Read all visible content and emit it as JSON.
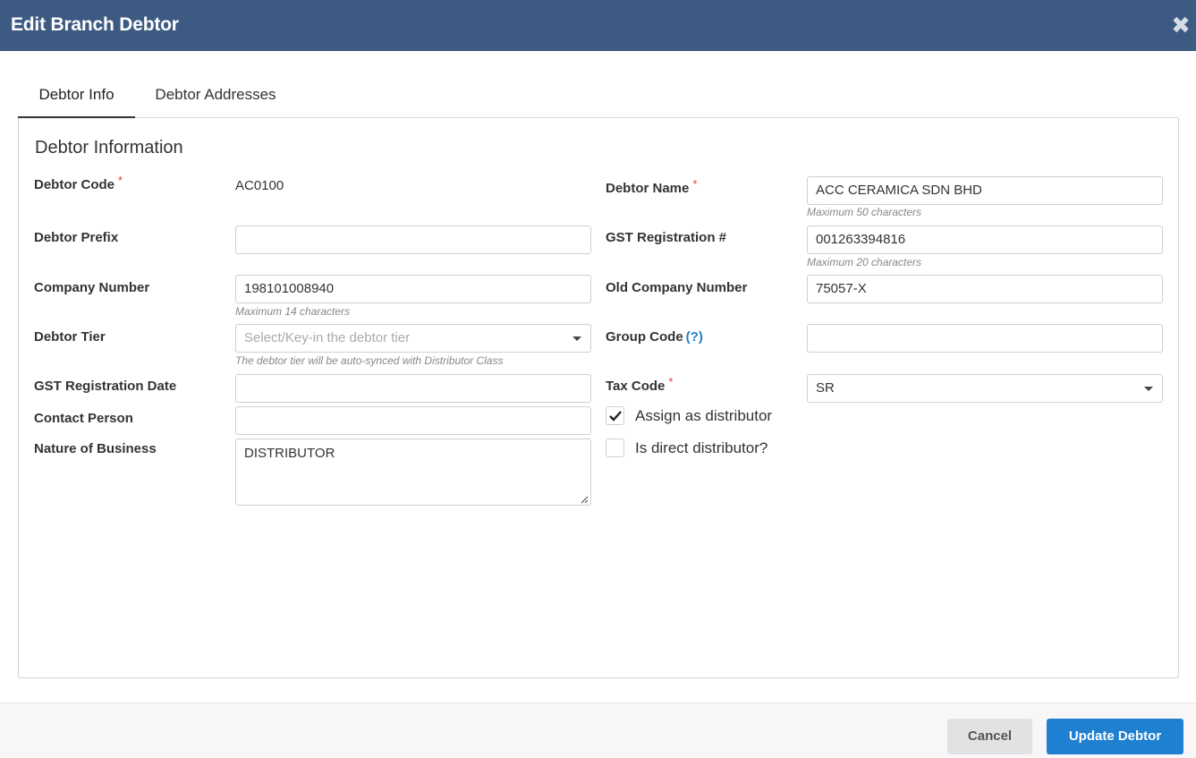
{
  "dialog": {
    "title": "Edit Branch Debtor"
  },
  "tabs": [
    {
      "label": "Debtor Info"
    },
    {
      "label": "Debtor Addresses"
    }
  ],
  "section": {
    "title": "Debtor Information"
  },
  "fields": {
    "debtor_code": {
      "label": "Debtor Code",
      "required_mark": "*",
      "value": "AC0100"
    },
    "debtor_prefix": {
      "label": "Debtor Prefix",
      "value": ""
    },
    "company_number": {
      "label": "Company Number",
      "value": "198101008940",
      "hint": "Maximum 14 characters"
    },
    "debtor_tier": {
      "label": "Debtor Tier",
      "placeholder": "Select/Key-in the debtor tier",
      "hint": "The debtor tier will be auto-synced with Distributor Class"
    },
    "gst_registration_date": {
      "label": "GST Registration Date",
      "value": ""
    },
    "contact_person": {
      "label": "Contact Person",
      "value": ""
    },
    "nature_of_business": {
      "label": "Nature of Business",
      "value": "DISTRIBUTOR"
    },
    "debtor_name": {
      "label": "Debtor Name",
      "required_mark": "*",
      "value": "ACC CERAMICA SDN BHD",
      "hint": "Maximum 50 characters"
    },
    "gst_registration_no": {
      "label": "GST Registration #",
      "value": "001263394816",
      "hint": "Maximum 20 characters"
    },
    "old_company_number": {
      "label": "Old Company Number",
      "value": "75057-X"
    },
    "group_code": {
      "label": "Group Code",
      "help": "(?)",
      "value": ""
    },
    "tax_code": {
      "label": "Tax Code",
      "required_mark": "*",
      "value": "SR"
    }
  },
  "checkboxes": {
    "assign_distributor": {
      "label": "Assign as distributor",
      "checked": true
    },
    "direct_distributor": {
      "label": "Is direct distributor?",
      "checked": false
    }
  },
  "footer": {
    "cancel_label": "Cancel",
    "update_label": "Update Debtor"
  },
  "colors": {
    "header_bg": "#3c5a82",
    "primary_button": "#1f7fd0",
    "required_mark": "#e23b3b",
    "help_link": "#1f7ec4"
  },
  "icons": {
    "close": "close-icon",
    "dropdown": "chevron-down-icon",
    "check": "checkmark-icon",
    "resize": "resize-handle-icon"
  }
}
